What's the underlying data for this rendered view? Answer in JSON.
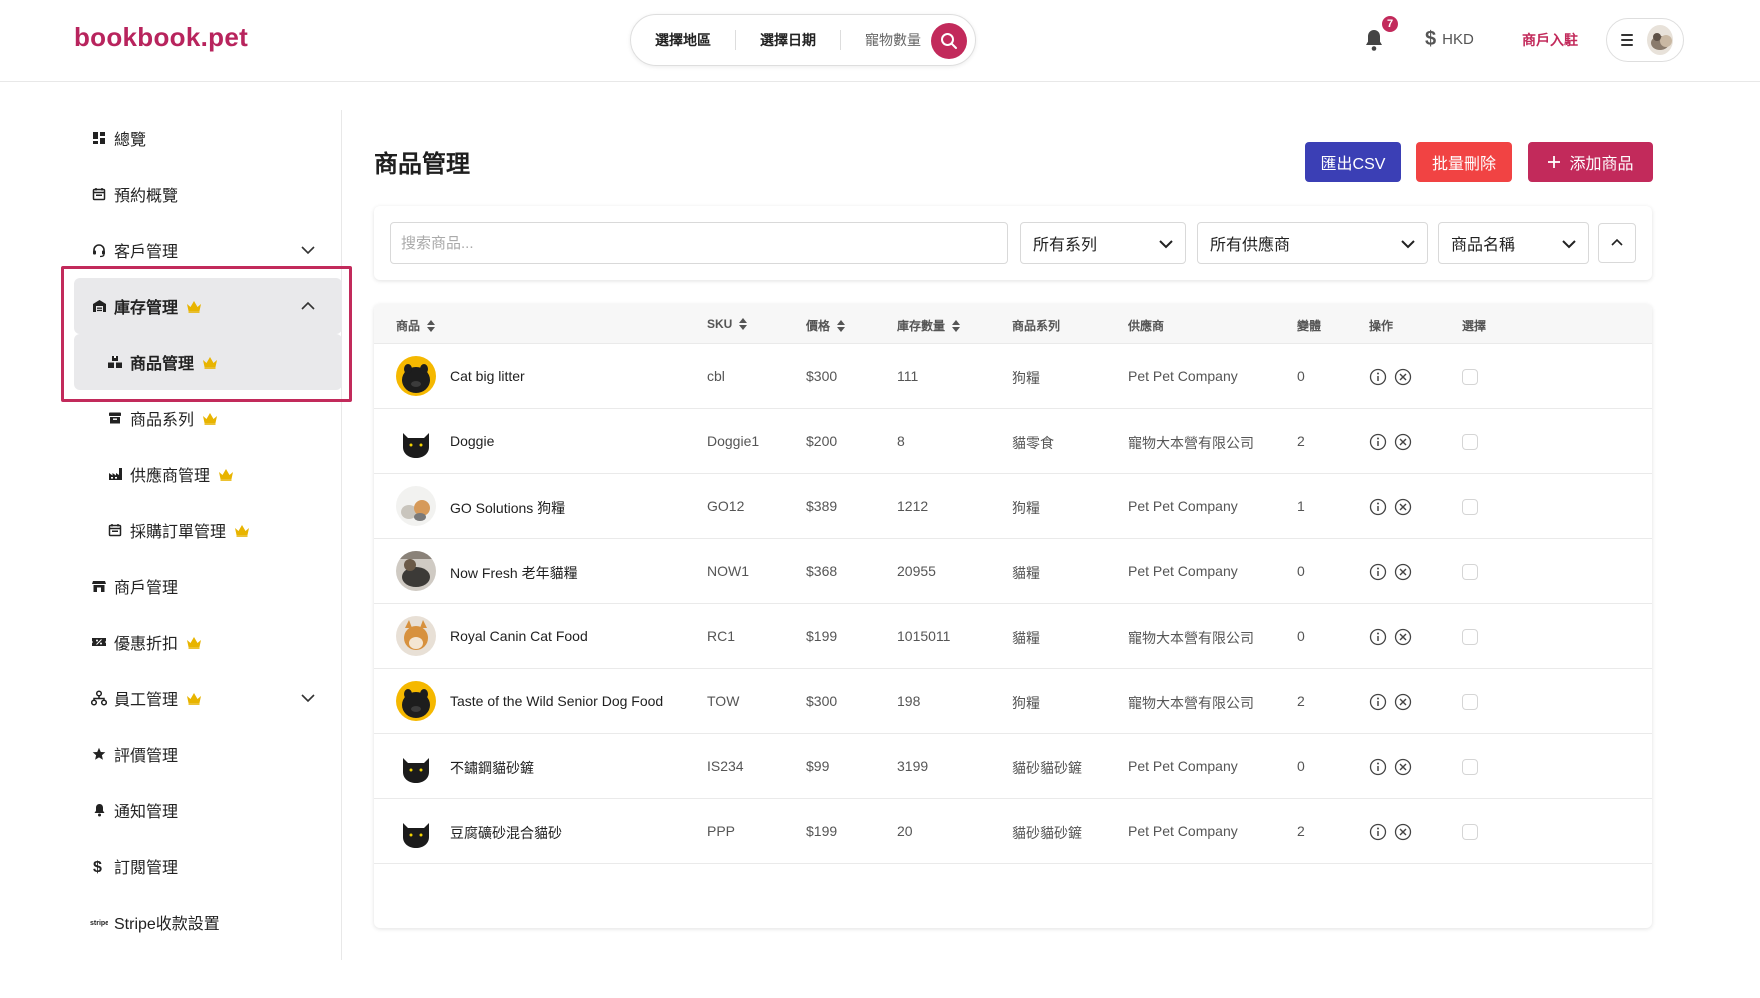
{
  "header": {
    "logo": "bookbook.pet",
    "search": {
      "region": "選擇地區",
      "date": "選擇日期",
      "pets": "寵物數量"
    },
    "notifications_count": "7",
    "currency": "HKD",
    "merchant_link": "商戶入駐"
  },
  "sidebar": {
    "items": [
      {
        "label": "總覽",
        "icon": "dashboard-icon"
      },
      {
        "label": "預約概覽",
        "icon": "calendar-icon"
      },
      {
        "label": "客戶管理",
        "icon": "headset-icon",
        "expandable": true
      },
      {
        "label": "庫存管理",
        "icon": "warehouse-icon",
        "crown": true,
        "expanded": true,
        "active": true
      },
      {
        "label": "商品管理",
        "icon": "boxes-icon",
        "crown": true,
        "sub": true,
        "active": true
      },
      {
        "label": "商品系列",
        "icon": "archive-icon",
        "crown": true,
        "sub": true
      },
      {
        "label": "供應商管理",
        "icon": "factory-icon",
        "crown": true,
        "sub": true
      },
      {
        "label": "採購訂單管理",
        "icon": "calendar-icon",
        "crown": true,
        "sub": true
      },
      {
        "label": "商戶管理",
        "icon": "store-icon"
      },
      {
        "label": "優惠折扣",
        "icon": "ticket-icon",
        "crown": true
      },
      {
        "label": "員工管理",
        "icon": "org-chart-icon",
        "crown": true,
        "expandable": true
      },
      {
        "label": "評價管理",
        "icon": "star-icon"
      },
      {
        "label": "通知管理",
        "icon": "bell-icon"
      },
      {
        "label": "訂閱管理",
        "icon": "dollar-icon"
      },
      {
        "label": "Stripe收款設置",
        "icon": "stripe-icon"
      }
    ]
  },
  "main": {
    "title": "商品管理",
    "buttons": {
      "export": "匯出CSV",
      "bulk_delete": "批量刪除",
      "add": "添加商品"
    },
    "filters": {
      "search_placeholder": "搜索商品...",
      "series": "所有系列",
      "supplier": "所有供應商",
      "sort_by": "商品名稱"
    },
    "table": {
      "headers": {
        "product": "商品",
        "sku": "SKU",
        "price": "價格",
        "stock": "庫存數量",
        "series": "商品系列",
        "supplier": "供應商",
        "variants": "變體",
        "actions": "操作",
        "select": "選擇"
      },
      "rows": [
        {
          "name": "Cat big litter",
          "sku": "cbl",
          "price": "$300",
          "stock": "111",
          "series": "狗糧",
          "supplier": "Pet Pet Company",
          "variants": "0",
          "thumb": "pug-yellow"
        },
        {
          "name": "Doggie",
          "sku": "Doggie1",
          "price": "$200",
          "stock": "8",
          "series": "貓零食",
          "supplier": "寵物大本營有限公司",
          "variants": "2",
          "thumb": "black-cat"
        },
        {
          "name": "GO Solutions 狗糧",
          "sku": "GO12",
          "price": "$389",
          "stock": "1212",
          "series": "狗糧",
          "supplier": "Pet Pet Company",
          "variants": "1",
          "thumb": "cats-photo"
        },
        {
          "name": "Now Fresh 老年貓糧",
          "sku": "NOW1",
          "price": "$368",
          "stock": "20955",
          "series": "貓糧",
          "supplier": "Pet Pet Company",
          "variants": "0",
          "thumb": "dog-photo"
        },
        {
          "name": "Royal Canin Cat Food",
          "sku": "RC1",
          "price": "$199",
          "stock": "1015011",
          "series": "貓糧",
          "supplier": "寵物大本營有限公司",
          "variants": "0",
          "thumb": "shiba-photo"
        },
        {
          "name": "Taste of the Wild Senior Dog Food",
          "sku": "TOW",
          "price": "$300",
          "stock": "198",
          "series": "狗糧",
          "supplier": "寵物大本營有限公司",
          "variants": "2",
          "thumb": "pug-yellow"
        },
        {
          "name": "不鏽鋼貓砂鏟",
          "sku": "IS234",
          "price": "$99",
          "stock": "3199",
          "series": "貓砂貓砂鏟",
          "supplier": "Pet Pet Company",
          "variants": "0",
          "thumb": "black-cat"
        },
        {
          "name": "豆腐礦砂混合貓砂",
          "sku": "PPP",
          "price": "$199",
          "stock": "20",
          "series": "貓砂貓砂鏟",
          "supplier": "Pet Pet Company",
          "variants": "2",
          "thumb": "black-cat"
        }
      ]
    }
  },
  "colors": {
    "brand": "#c22a5b",
    "export": "#3b3fb5",
    "delete": "#f14343",
    "crown": "#e8b400"
  }
}
